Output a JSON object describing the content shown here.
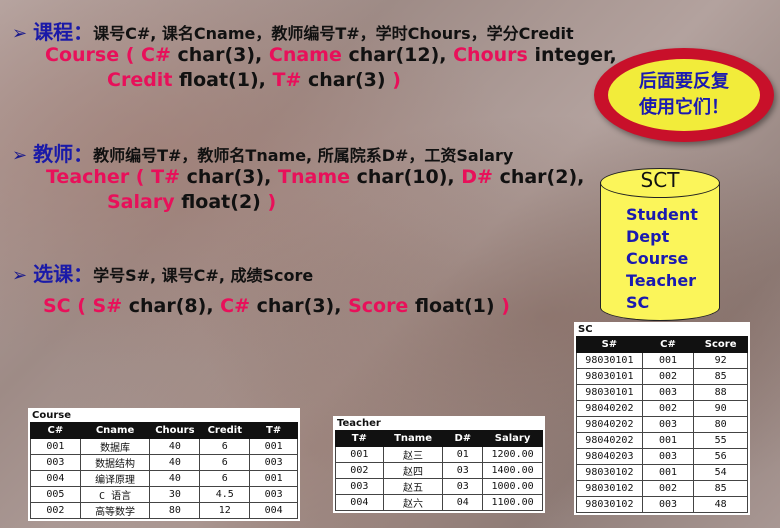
{
  "sections": [
    {
      "heading": "课程：",
      "desc": "课号C#, 课名Cname，教师编号T#，学时Chours，学分Credit",
      "line1": [
        {
          "t": "Course ( C# ",
          "c": "r"
        },
        {
          "t": " char(3), ",
          "c": "k"
        },
        {
          "t": " Cname ",
          "c": "r"
        },
        {
          "t": " char(12), ",
          "c": "k"
        },
        {
          "t": "Chours",
          "c": "r"
        },
        {
          "t": " integer,",
          "c": "k"
        }
      ],
      "line2": [
        {
          "t": "Credit ",
          "c": "r"
        },
        {
          "t": " float(1), ",
          "c": "k"
        },
        {
          "t": " T#",
          "c": "r"
        },
        {
          "t": " char(3) ",
          "c": "k"
        },
        {
          "t": ")",
          "c": "r"
        }
      ]
    },
    {
      "heading": "教师：",
      "desc": "教师编号T#，教师名Tname, 所属院系D#，工资Salary",
      "line1": [
        {
          "t": "Teacher ( T# ",
          "c": "r"
        },
        {
          "t": " char(3), ",
          "c": "k"
        },
        {
          "t": "Tname ",
          "c": "r"
        },
        {
          "t": " char(10), ",
          "c": "k"
        },
        {
          "t": "D#",
          "c": "r"
        },
        {
          "t": " char(2),",
          "c": "k"
        }
      ],
      "line2": [
        {
          "t": "Salary ",
          "c": "r"
        },
        {
          "t": " float(2) ",
          "c": "k"
        },
        {
          "t": ")",
          "c": "r"
        }
      ]
    },
    {
      "heading": "选课：",
      "desc": "学号S#, 课号C#, 成绩Score",
      "line1": [
        {
          "t": "SC ( S# ",
          "c": "r"
        },
        {
          "t": " char(8), ",
          "c": "k"
        },
        {
          "t": "C# ",
          "c": "r"
        },
        {
          "t": " char(3), ",
          "c": "k"
        },
        {
          "t": "Score ",
          "c": "r"
        },
        {
          "t": " float(1) ",
          "c": "k"
        },
        {
          "t": ")",
          "c": "r"
        }
      ]
    }
  ],
  "callout": {
    "line1": "后面要反复",
    "line2": "使用它们！"
  },
  "database": {
    "name": "SCT",
    "tables": [
      "Student",
      "Dept",
      "Course",
      "Teacher",
      "SC"
    ]
  },
  "course_table": {
    "caption": "Course",
    "headers": [
      "C#",
      "Cname",
      "Chours",
      "Credit",
      "T#"
    ],
    "rows": [
      [
        "001",
        "数据库",
        "40",
        "6",
        "001"
      ],
      [
        "003",
        "数据结构",
        "40",
        "6",
        "003"
      ],
      [
        "004",
        "编译原理",
        "40",
        "6",
        "001"
      ],
      [
        "005",
        "C 语言",
        "30",
        "4.5",
        "003"
      ],
      [
        "002",
        "高等数学",
        "80",
        "12",
        "004"
      ]
    ]
  },
  "teacher_table": {
    "caption": "Teacher",
    "headers": [
      "T#",
      "Tname",
      "D#",
      "Salary"
    ],
    "rows": [
      [
        "001",
        "赵三",
        "01",
        "1200.00"
      ],
      [
        "002",
        "赵四",
        "03",
        "1400.00"
      ],
      [
        "003",
        "赵五",
        "03",
        "1000.00"
      ],
      [
        "004",
        "赵六",
        "04",
        "1100.00"
      ]
    ]
  },
  "sc_table": {
    "caption": "SC",
    "headers": [
      "S#",
      "C#",
      "Score"
    ],
    "rows": [
      [
        "98030101",
        "001",
        "92"
      ],
      [
        "98030101",
        "002",
        "85"
      ],
      [
        "98030101",
        "003",
        "88"
      ],
      [
        "98040202",
        "002",
        "90"
      ],
      [
        "98040202",
        "003",
        "80"
      ],
      [
        "98040202",
        "001",
        "55"
      ],
      [
        "98040203",
        "003",
        "56"
      ],
      [
        "98030102",
        "001",
        "54"
      ],
      [
        "98030102",
        "002",
        "85"
      ],
      [
        "98030102",
        "003",
        "48"
      ]
    ]
  }
}
